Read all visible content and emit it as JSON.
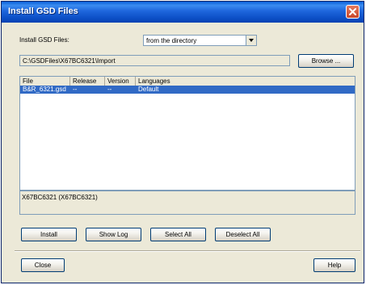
{
  "window": {
    "title": "Install GSD Files"
  },
  "source": {
    "label": "Install GSD Files:",
    "selected": "from the directory"
  },
  "path": {
    "value": "C:\\GSDFiles\\X67BC6321\\Import",
    "browse_label": "Browse ..."
  },
  "table": {
    "columns": [
      "File",
      "Release",
      "Version",
      "Languages"
    ],
    "rows": [
      {
        "file": "B&R_6321.gsd",
        "release": "--",
        "version": "--",
        "languages": "Default",
        "selected": true
      }
    ]
  },
  "info": {
    "text": "X67BC6321 (X67BC6321)"
  },
  "actions": {
    "install": "Install",
    "show_log": "Show Log",
    "select_all": "Select All",
    "deselect_all": "Deselect All"
  },
  "footer": {
    "close": "Close",
    "help": "Help"
  },
  "colors": {
    "titlebar": "#0b4ec5",
    "selection": "#316ac5",
    "dialog_bg": "#ece9d8",
    "close_button": "#c9472a"
  }
}
